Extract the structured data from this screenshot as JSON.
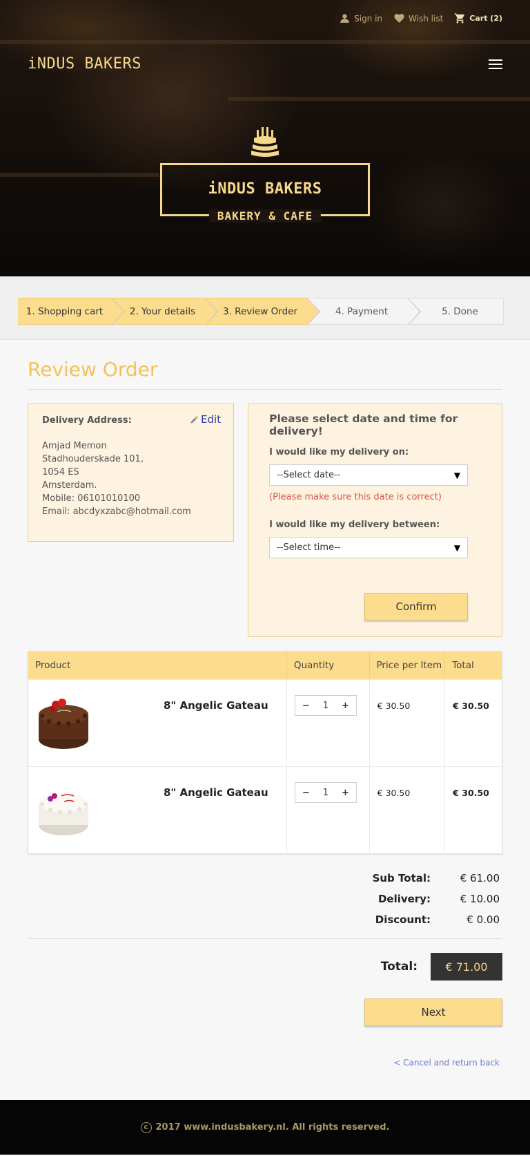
{
  "header": {
    "sign_in": "Sign in",
    "wish_list": "Wish list",
    "cart": "Cart (2)",
    "brand": "iNDUS BAKERS",
    "logo_title": "iNDUS BAKERS",
    "logo_subtitle": "BAKERY & CAFE"
  },
  "steps": [
    {
      "label": "1. Shopping cart",
      "active": true
    },
    {
      "label": "2. Your details",
      "active": true
    },
    {
      "label": "3. Review Order",
      "active": true
    },
    {
      "label": "4. Payment",
      "active": false
    },
    {
      "label": "5. Done",
      "active": false
    }
  ],
  "page_title": "Review Order",
  "address": {
    "label": "Delivery Address:",
    "edit": "Edit",
    "name": "Amjad Memon",
    "street": "Stadhouderskade 101,",
    "postcode": "1054 ES",
    "city": "Amsterdam.",
    "mobile": "Mobile: 06101010100",
    "email": "Email: abcdyxzabc@hotmail.com"
  },
  "delivery": {
    "heading": "Please select date and time for delivery!",
    "date_label": "I would like my delivery on:",
    "date_value": "--Select date--",
    "warning": "(Please make sure this date is correct)",
    "time_label": "I would like my delivery between:",
    "time_value": "--Select time--",
    "confirm": "Confirm"
  },
  "table": {
    "headers": {
      "product": "Product",
      "quantity": "Quantity",
      "price": "Price per Item",
      "total": "Total"
    },
    "rows": [
      {
        "name": "8\" Angelic Gateau",
        "qty": "1",
        "price": "€ 30.50",
        "total": "€ 30.50",
        "image": "chocolate-cake"
      },
      {
        "name": "8\" Angelic Gateau",
        "qty": "1",
        "price": "€ 30.50",
        "total": "€ 30.50",
        "image": "white-cream-cake"
      }
    ]
  },
  "totals": {
    "subtotal_label": "Sub Total:",
    "subtotal": "€ 61.00",
    "delivery_label": "Delivery:",
    "delivery": "€ 10.00",
    "discount_label": "Discount:",
    "discount": "€ 0.00",
    "total_label": "Total:",
    "total": "€ 71.00"
  },
  "next": "Next",
  "cancel": "< Cancel and return back",
  "footer": "2017 www.indusbakery.nl. All rights reserved.",
  "colors": {
    "accent": "#fcdc8d",
    "title": "#f2c35a",
    "dark": "#333333",
    "link": "#2e3e9e"
  }
}
